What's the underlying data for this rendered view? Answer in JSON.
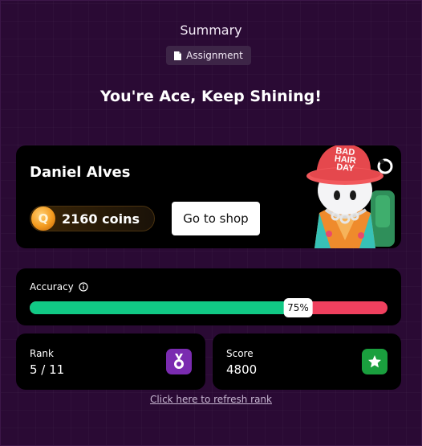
{
  "header": {
    "title": "Summary",
    "type_badge": "Assignment"
  },
  "headline": "You're Ace, Keep Shining!",
  "player": {
    "name": "Daniel Alves",
    "coins_text": "2160 coins",
    "shop_button_label": "Go to shop",
    "avatar_hat_text": [
      "BAD",
      "HAIR",
      "DAY"
    ],
    "avatar_icon": "avatar-character-icon"
  },
  "accuracy": {
    "label": "Accuracy",
    "value_label": "75%",
    "value": 0.75,
    "info_icon": "info-icon"
  },
  "rank": {
    "label": "Rank",
    "value": "5 / 11",
    "icon": "medal-icon"
  },
  "score": {
    "label": "Score",
    "value": "4800",
    "icon": "star-icon"
  },
  "refresh_link": "Click here to refresh rank",
  "colors": {
    "background": "#2a0a34",
    "card": "#000000",
    "correct": "#11c985",
    "incorrect": "#f0405e",
    "rank_icon_bg": "#7a2bb0",
    "score_icon_bg": "#1a9f3e",
    "coin": "#f39a1e"
  }
}
